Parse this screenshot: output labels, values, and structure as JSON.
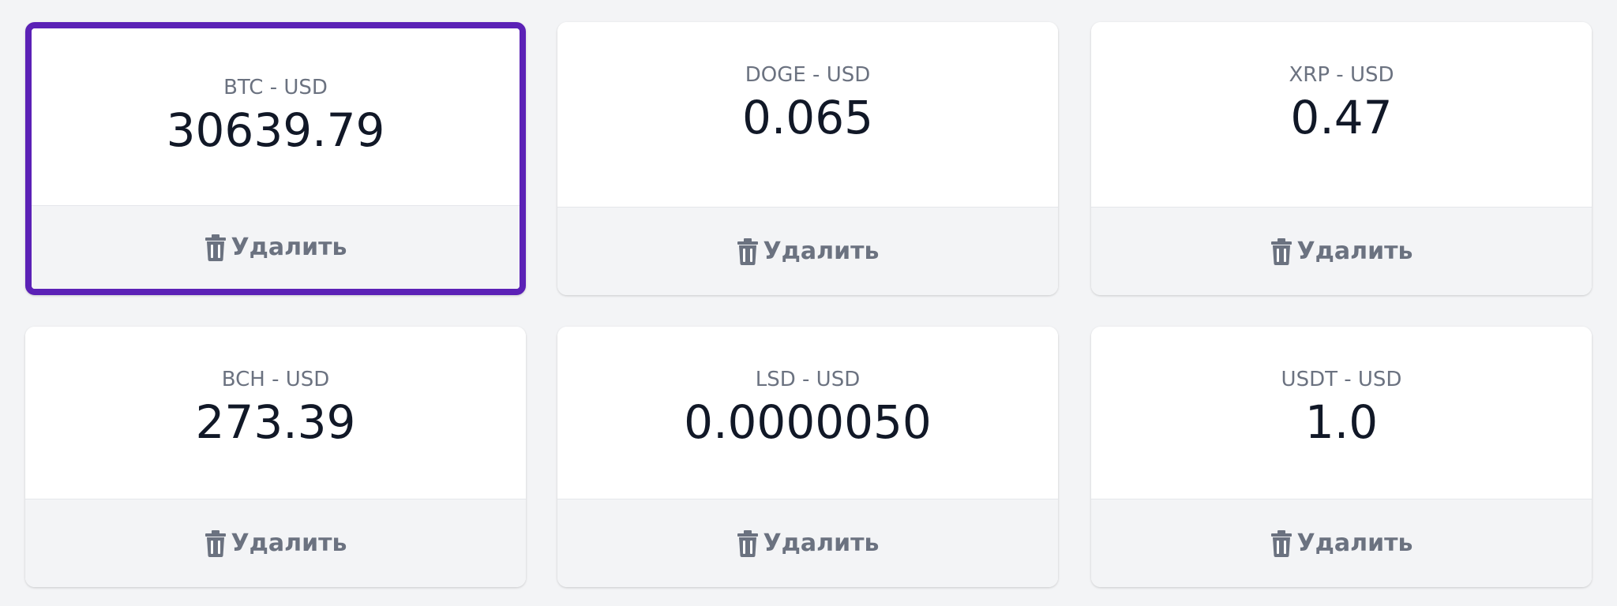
{
  "accent_color": "#5b21b6",
  "selected_index": 0,
  "delete_icon": "trash-icon",
  "tickers": [
    {
      "label": "BTC - USD",
      "price": "30639.79",
      "delete_label": "Удалить"
    },
    {
      "label": "DOGE - USD",
      "price": "0.065",
      "delete_label": "Удалить"
    },
    {
      "label": "XRP - USD",
      "price": "0.47",
      "delete_label": "Удалить"
    },
    {
      "label": "BCH - USD",
      "price": "273.39",
      "delete_label": "Удалить"
    },
    {
      "label": "LSD - USD",
      "price": "0.0000050",
      "delete_label": "Удалить"
    },
    {
      "label": "USDT - USD",
      "price": "1.0",
      "delete_label": "Удалить"
    }
  ]
}
